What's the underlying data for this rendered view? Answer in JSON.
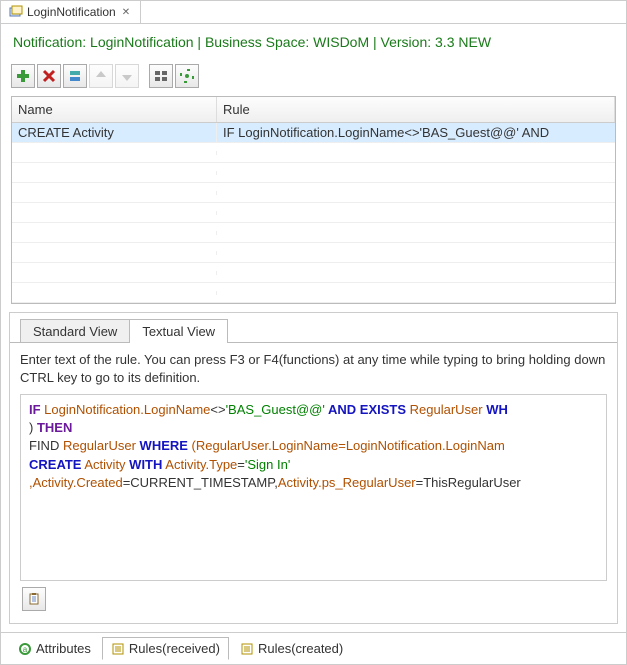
{
  "editor_tab": {
    "title": "LoginNotification"
  },
  "header_line": "Notification: LoginNotification   |   Business Space: WISDoM   |   Version: 3.3 NEW",
  "table": {
    "col_name": "Name",
    "col_rule": "Rule",
    "rows": [
      {
        "name": "CREATE Activity",
        "rule": "IF LoginNotification.LoginName<>'BAS_Guest@@'  AND"
      }
    ]
  },
  "views": {
    "standard": "Standard View",
    "textual": "Textual View"
  },
  "hint": "Enter text of the rule. You can press F3 or F4(functions) at any time while typing to bring holding down CTRL key to go to its definition.",
  "rule_text": {
    "l1_if": "IF",
    "l1_a": " LoginNotification.LoginName",
    "l1_b": "<>",
    "l1_c": "'BAS_Guest@@'",
    "l1_d": "  AND EXISTS ",
    "l1_e": "RegularUser ",
    "l1_f": "WH",
    "l2_a": ") ",
    "l2_then": "THEN",
    "l3_a": "   FIND ",
    "l3_b": "RegularUser ",
    "l3_where": "WHERE",
    "l3_c": " (RegularUser.LoginName=LoginNotification.LoginNam",
    "l4_create": "    CREATE",
    "l4_a": " Activity ",
    "l4_with": "WITH",
    "l4_b": " Activity.Type",
    "l4_c": "=",
    "l4_d": "'Sign In'",
    "l5_a": ",Activity.Created",
    "l5_b": "=CURRENT_TIMESTAMP,",
    "l5_c": "Activity.ps_RegularUser",
    "l5_d": "=ThisRegularUser"
  },
  "bottom_tabs": {
    "attributes": "Attributes",
    "rules_received": "Rules(received)",
    "rules_created": "Rules(created)"
  }
}
